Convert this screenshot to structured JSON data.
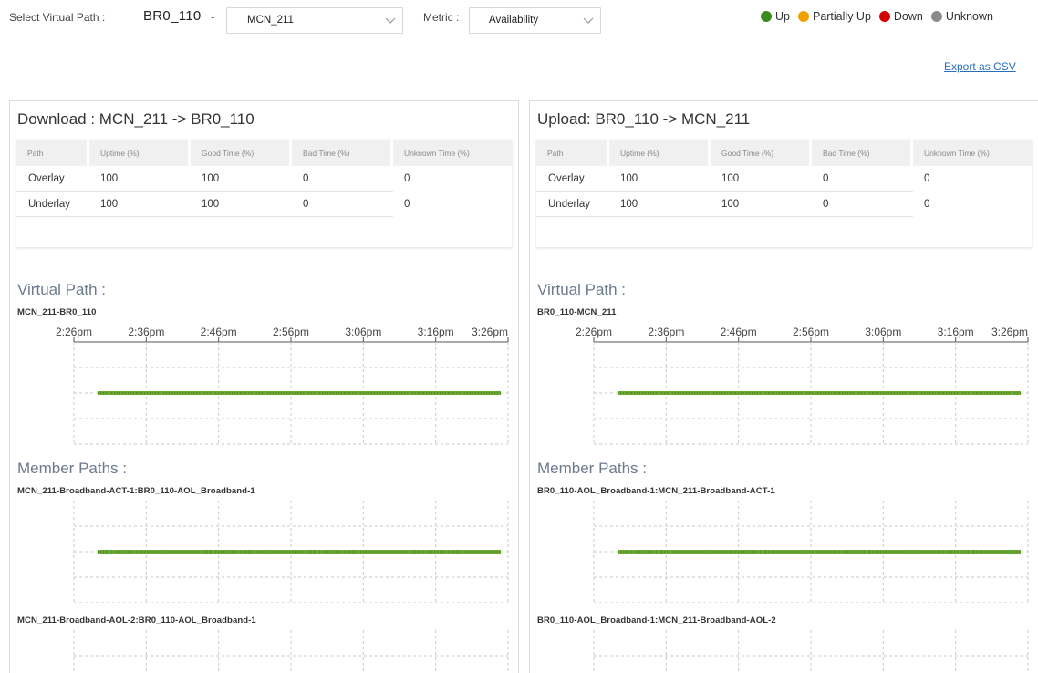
{
  "toolbar": {
    "select_label": "Select Virtual Path :",
    "source_path": "BR0_110",
    "separator": "-",
    "path_dropdown_value": "MCN_211",
    "metric_label": "Metric :",
    "metric_dropdown_value": "Availability",
    "export_label": "Export as CSV"
  },
  "legend": [
    {
      "label": "Up",
      "color": "#3a8a1f"
    },
    {
      "label": "Partially Up",
      "color": "#f0a000"
    },
    {
      "label": "Down",
      "color": "#d40000"
    },
    {
      "label": "Unknown",
      "color": "#8a8a8a"
    }
  ],
  "table_headers": [
    "Path",
    "Uptime (%)",
    "Good Time (%)",
    "Bad Time (%)",
    "Unknown Time (%)"
  ],
  "time_ticks": [
    "2:26pm",
    "2:36pm",
    "2:46pm",
    "2:56pm",
    "3:06pm",
    "3:16pm",
    "3:26pm"
  ],
  "availability_color": "#6aa832",
  "panels": {
    "download": {
      "title": "Download : MCN_211 -> BR0_110",
      "rows": [
        [
          "Overlay",
          "100",
          "100",
          "0",
          "0"
        ],
        [
          "Underlay",
          "100",
          "100",
          "0",
          "0"
        ]
      ],
      "virtual_path_heading": "Virtual Path :",
      "virtual_path_name": "MCN_211-BR0_110",
      "member_paths_heading": "Member Paths :",
      "member_paths": [
        "MCN_211-Broadband-ACT-1:BR0_110-AOL_Broadband-1",
        "MCN_211-Broadband-AOL-2:BR0_110-AOL_Broadband-1"
      ]
    },
    "upload": {
      "title": "Upload: BR0_110 -> MCN_211",
      "rows": [
        [
          "Overlay",
          "100",
          "100",
          "0",
          "0"
        ],
        [
          "Underlay",
          "100",
          "100",
          "0",
          "0"
        ]
      ],
      "virtual_path_heading": "Virtual Path :",
      "virtual_path_name": "BR0_110-MCN_211",
      "member_paths_heading": "Member Paths :",
      "member_paths": [
        "BR0_110-AOL_Broadband-1:MCN_211-Broadband-ACT-1",
        "BR0_110-AOL_Broadband-1:MCN_211-Broadband-AOL-2"
      ]
    }
  }
}
